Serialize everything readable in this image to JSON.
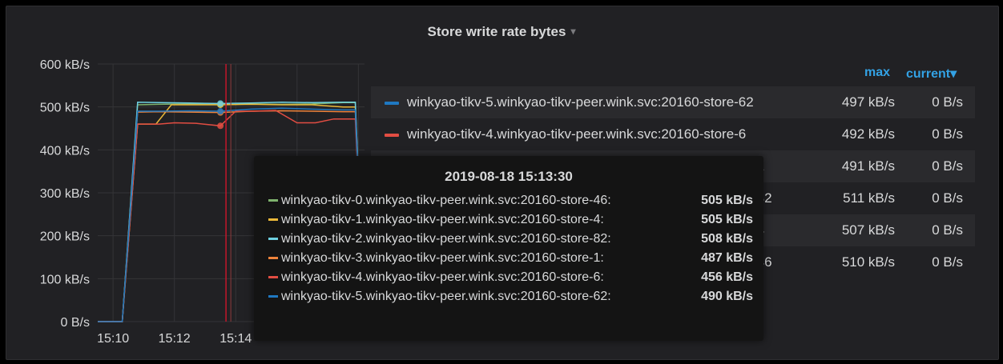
{
  "panel": {
    "title": "Store write rate bytes",
    "menu_caret": "▾"
  },
  "legend": {
    "headers": {
      "max": "max",
      "current": "current▾"
    },
    "rows": [
      {
        "name": "winkyao-tikv-5.winkyao-tikv-peer.wink.svc:20160-store-62",
        "max": "497 kB/s",
        "current": "0 B/s",
        "color": "#1f78c1"
      },
      {
        "name": "winkyao-tikv-4.winkyao-tikv-peer.wink.svc:20160-store-6",
        "max": "492 kB/s",
        "current": "0 B/s",
        "color": "#e24d42"
      },
      {
        "name": "-1",
        "max": "491 kB/s",
        "current": "0 B/s",
        "color": "#ef843c"
      },
      {
        "name": "-82",
        "max": "511 kB/s",
        "current": "0 B/s",
        "color": "#6ed0e0"
      },
      {
        "name": "-4",
        "max": "507 kB/s",
        "current": "0 B/s",
        "color": "#eab839"
      },
      {
        "name": "-46",
        "max": "510 kB/s",
        "current": "0 B/s",
        "color": "#7eb26d"
      }
    ]
  },
  "tooltip": {
    "time": "2019-08-18 15:13:30",
    "rows": [
      {
        "name": "winkyao-tikv-0.winkyao-tikv-peer.wink.svc:20160-store-46:",
        "value": "505 kB/s",
        "color": "#7eb26d"
      },
      {
        "name": "winkyao-tikv-1.winkyao-tikv-peer.wink.svc:20160-store-4:",
        "value": "505 kB/s",
        "color": "#eab839"
      },
      {
        "name": "winkyao-tikv-2.winkyao-tikv-peer.wink.svc:20160-store-82:",
        "value": "508 kB/s",
        "color": "#6ed0e0"
      },
      {
        "name": "winkyao-tikv-3.winkyao-tikv-peer.wink.svc:20160-store-1:",
        "value": "487 kB/s",
        "color": "#ef843c"
      },
      {
        "name": "winkyao-tikv-4.winkyao-tikv-peer.wink.svc:20160-store-6:",
        "value": "456 kB/s",
        "color": "#e24d42"
      },
      {
        "name": "winkyao-tikv-5.winkyao-tikv-peer.wink.svc:20160-store-62:",
        "value": "490 kB/s",
        "color": "#1f78c1"
      }
    ]
  },
  "chart_data": {
    "type": "line",
    "title": "Store write rate bytes",
    "y_ticks": [
      "600 kB/s",
      "500 kB/s",
      "400 kB/s",
      "300 kB/s",
      "200 kB/s",
      "100 kB/s",
      "0 B/s"
    ],
    "x_ticks": [
      "15:10",
      "15:12",
      "15:14"
    ],
    "ylim": [
      0,
      600
    ],
    "x_unit": "minutes",
    "xlim": [
      9.5,
      18.2
    ],
    "hover_x": 13.5,
    "grid": true,
    "series": [
      {
        "name": "winkyao-tikv-0.winkyao-tikv-peer.wink.svc:20160-store-46",
        "color": "#7eb26d",
        "x": [
          9.5,
          10.3,
          10.8,
          11.5,
          12.5,
          13.5,
          14.5,
          15.5,
          16.5,
          17.5,
          17.9,
          18.2
        ],
        "y": [
          0,
          0,
          505,
          506,
          507,
          505,
          507,
          506,
          507,
          510,
          510,
          0
        ]
      },
      {
        "name": "winkyao-tikv-1.winkyao-tikv-peer.wink.svc:20160-store-4",
        "color": "#eab839",
        "x": [
          9.5,
          10.3,
          10.8,
          11.4,
          11.9,
          12.5,
          13.5,
          14.5,
          15.5,
          16.5,
          17.5,
          17.9,
          18.2
        ],
        "y": [
          0,
          0,
          460,
          460,
          505,
          505,
          505,
          506,
          505,
          505,
          500,
          500,
          0
        ]
      },
      {
        "name": "winkyao-tikv-2.winkyao-tikv-peer.wink.svc:20160-store-82",
        "color": "#6ed0e0",
        "x": [
          9.5,
          10.3,
          10.8,
          11.5,
          12.5,
          13.5,
          14.5,
          15.5,
          16.5,
          17.5,
          17.9,
          18.2
        ],
        "y": [
          0,
          0,
          511,
          510,
          509,
          508,
          509,
          511,
          510,
          511,
          511,
          0
        ]
      },
      {
        "name": "winkyao-tikv-3.winkyao-tikv-peer.wink.svc:20160-store-1",
        "color": "#ef843c",
        "x": [
          9.5,
          10.3,
          10.8,
          11.5,
          12.5,
          13.5,
          14.5,
          15.5,
          16.5,
          17.5,
          17.9,
          18.2
        ],
        "y": [
          0,
          0,
          488,
          489,
          488,
          487,
          490,
          491,
          490,
          489,
          489,
          0
        ]
      },
      {
        "name": "winkyao-tikv-4.winkyao-tikv-peer.wink.svc:20160-store-6",
        "color": "#e24d42",
        "x": [
          9.5,
          10.3,
          10.8,
          11.5,
          12.0,
          12.7,
          13.5,
          14.0,
          14.6,
          15.3,
          16.0,
          16.6,
          17.2,
          17.6,
          17.9,
          18.2
        ],
        "y": [
          0,
          0,
          460,
          460,
          463,
          462,
          456,
          490,
          490,
          492,
          463,
          463,
          472,
          472,
          472,
          0
        ]
      },
      {
        "name": "winkyao-tikv-5.winkyao-tikv-peer.wink.svc:20160-store-62",
        "color": "#1f78c1",
        "x": [
          9.5,
          10.3,
          10.8,
          11.5,
          12.5,
          13.5,
          14.5,
          15.5,
          16.5,
          17.5,
          17.9,
          18.2
        ],
        "y": [
          0,
          0,
          490,
          490,
          491,
          490,
          495,
          497,
          495,
          493,
          493,
          0
        ]
      }
    ]
  }
}
